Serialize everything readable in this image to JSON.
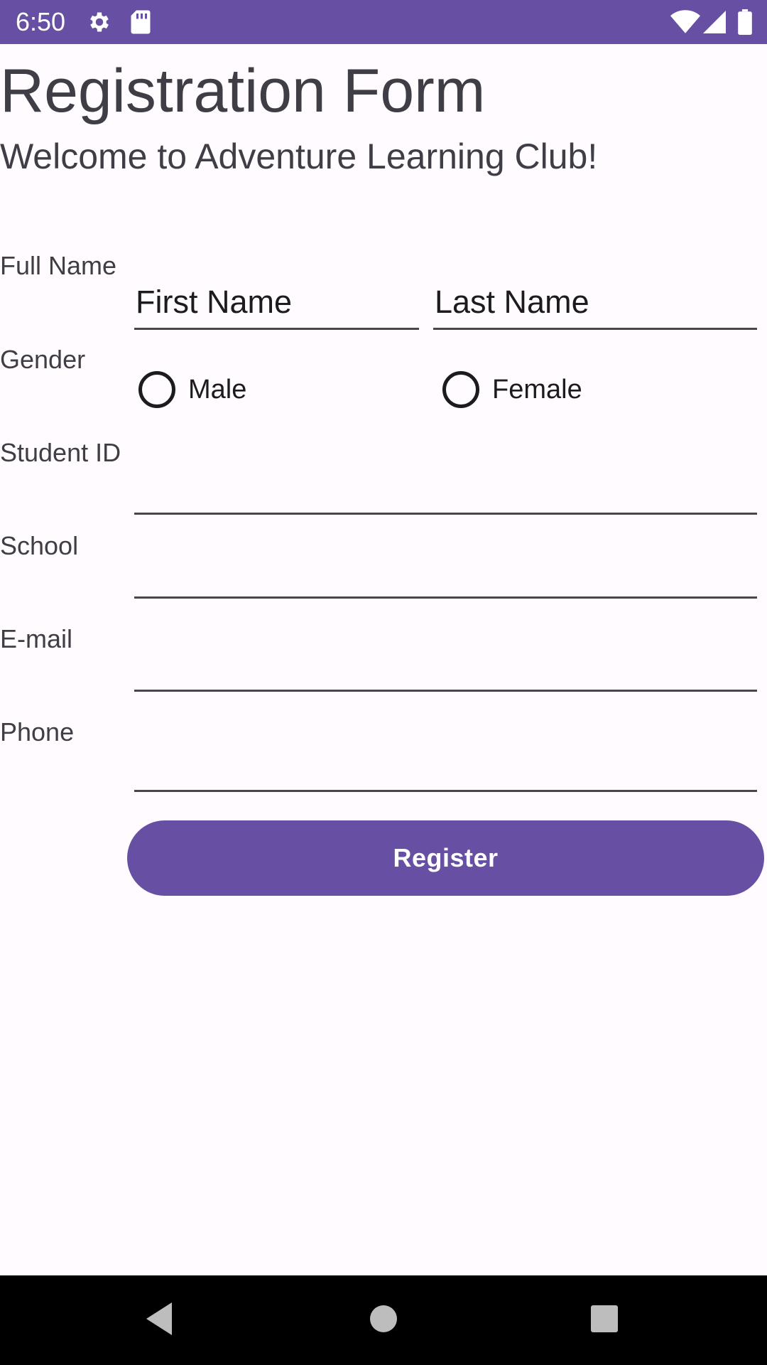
{
  "status_bar": {
    "time": "6:50",
    "icons": [
      "gear-icon",
      "sd-card-icon",
      "wifi-icon",
      "signal-icon",
      "battery-icon"
    ],
    "background": "#6750a4"
  },
  "header": {
    "title": "Registration Form",
    "subtitle": "Welcome to Adventure Learning Club!"
  },
  "form": {
    "full_name": {
      "label": "Full Name",
      "first_placeholder": "First Name",
      "last_placeholder": "Last Name"
    },
    "gender": {
      "label": "Gender",
      "options": [
        "Male",
        "Female"
      ],
      "selected": null
    },
    "student_id": {
      "label": "Student ID",
      "value": ""
    },
    "school": {
      "label": "School",
      "value": ""
    },
    "email": {
      "label": "E-mail",
      "value": ""
    },
    "phone": {
      "label": "Phone",
      "value": ""
    },
    "submit_label": "Register"
  },
  "nav_bar": {
    "buttons": [
      "back-icon",
      "home-icon",
      "recents-icon"
    ]
  },
  "colors": {
    "accent": "#6750a4",
    "background": "#fffbfe",
    "text": "#3f3d45"
  }
}
